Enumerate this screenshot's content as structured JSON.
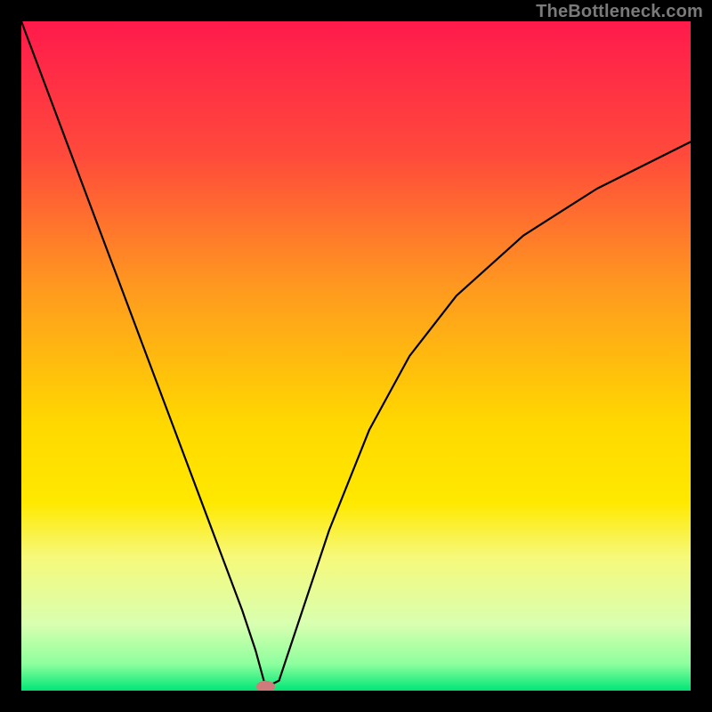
{
  "attribution": "TheBottleneck.com",
  "chart_data": {
    "type": "line",
    "title": "",
    "xlabel": "",
    "ylabel": "",
    "xlim": [
      0,
      100
    ],
    "ylim": [
      0,
      100
    ],
    "y_inverted": false,
    "background_gradient_stops": [
      {
        "offset": 0.0,
        "color": "#ff1a4c"
      },
      {
        "offset": 0.2,
        "color": "#ff4a3b"
      },
      {
        "offset": 0.4,
        "color": "#ff9a1f"
      },
      {
        "offset": 0.6,
        "color": "#ffd800"
      },
      {
        "offset": 0.72,
        "color": "#ffe900"
      },
      {
        "offset": 0.8,
        "color": "#f6f97a"
      },
      {
        "offset": 0.9,
        "color": "#d9ffb0"
      },
      {
        "offset": 0.96,
        "color": "#8eff9e"
      },
      {
        "offset": 1.0,
        "color": "#00e676"
      }
    ],
    "series": [
      {
        "name": "bottleneck-curve",
        "stroke": "#000000",
        "stroke_width": 2.2,
        "x": [
          0,
          3,
          6,
          9,
          12,
          15,
          18,
          21,
          24,
          27,
          30,
          33,
          35,
          36.5,
          38.5,
          42,
          46,
          52,
          58,
          65,
          75,
          86,
          100
        ],
        "values": [
          100,
          92,
          84,
          76,
          68,
          60,
          52,
          44,
          36,
          28,
          20,
          12,
          6,
          0.5,
          1.5,
          12,
          24,
          39,
          50,
          59,
          68,
          75,
          82
        ]
      }
    ],
    "marker": {
      "name": "sweet-spot",
      "shape": "ellipse",
      "cx": 36.5,
      "cy": 0.6,
      "rx": 1.4,
      "ry": 0.9,
      "fill": "#d07b7b"
    }
  }
}
